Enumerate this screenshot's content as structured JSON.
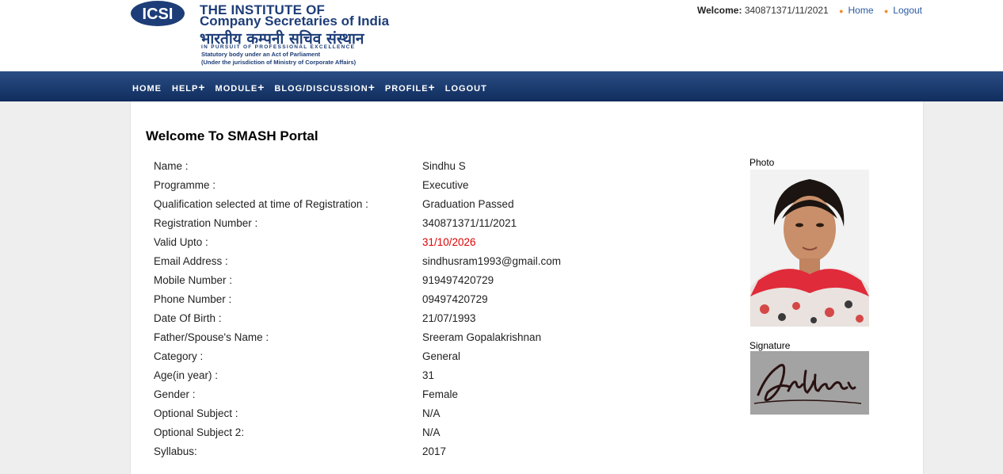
{
  "header": {
    "logo": {
      "mark": "ICSI",
      "line1": "THE INSTITUTE OF",
      "line2": "Company Secretaries of India",
      "line3": "भारतीय कम्पनी सचिव संस्थान",
      "line4": "IN PURSUIT OF PROFESSIONAL EXCELLENCE",
      "line5": "Statutory body under an Act of Parliament",
      "line6": "(Under the jurisdiction of Ministry of Corporate Affairs)"
    },
    "welcome_label": "Welcome:",
    "welcome_id": "340871371/11/2021",
    "home_link": "Home",
    "logout_link": "Logout"
  },
  "nav": [
    {
      "label": "HOME",
      "plus": ""
    },
    {
      "label": "HELP",
      "plus": "+"
    },
    {
      "label": "MODULE",
      "plus": "+"
    },
    {
      "label": "BLOG/DISCUSSION",
      "plus": "+"
    },
    {
      "label": "PROFILE",
      "plus": "+"
    },
    {
      "label": "LOGOUT",
      "plus": ""
    }
  ],
  "main": {
    "title": "Welcome To SMASH Portal",
    "photo_label": "Photo",
    "signature_label": "Signature",
    "rows": [
      {
        "label": "Name :",
        "value": "Sindhu S"
      },
      {
        "label": "Programme :",
        "value": "Executive"
      },
      {
        "label": "Qualification selected at time of Registration :",
        "value": "Graduation Passed"
      },
      {
        "label": "Registration Number :",
        "value": "340871371/11/2021"
      },
      {
        "label": "Valid Upto :",
        "value": "31/10/2026"
      },
      {
        "label": "Email Address :",
        "value": "sindhusram1993@gmail.com"
      },
      {
        "label": "Mobile Number :",
        "value": "919497420729"
      },
      {
        "label": "Phone Number :",
        "value": "09497420729"
      },
      {
        "label": "Date Of Birth :",
        "value": "21/07/1993"
      },
      {
        "label": "Father/Spouse's Name :",
        "value": "Sreeram Gopalakrishnan"
      },
      {
        "label": "Category :",
        "value": "General"
      },
      {
        "label": "Age(in year) :",
        "value": "31"
      },
      {
        "label": "Gender :",
        "value": "Female"
      },
      {
        "label": "Optional Subject :",
        "value": "N/A"
      },
      {
        "label": "Optional Subject 2:",
        "value": "N/A"
      },
      {
        "label": "Syllabus:",
        "value": "2017"
      }
    ]
  },
  "colors": {
    "nav_bg": "#1a3a6e",
    "brand": "#1d3d78",
    "valid_upto": "#e00000",
    "link": "#2a5aa0"
  }
}
